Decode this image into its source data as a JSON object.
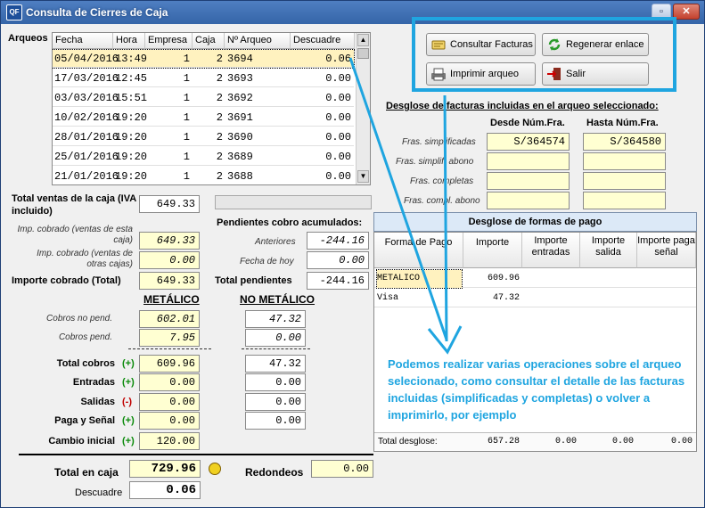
{
  "window": {
    "app_icon": "QF",
    "title": "Consulta de Cierres de Caja",
    "minimize": "▫",
    "close": "✕"
  },
  "arqueos": {
    "label": "Arqueos",
    "columns": [
      "Fecha",
      "Hora",
      "Empresa",
      "Caja",
      "Nº Arqueo",
      "Descuadre"
    ],
    "rows": [
      [
        "05/04/2016",
        "13:49",
        "1",
        "2",
        "3694",
        "0.06"
      ],
      [
        "17/03/2016",
        "12:45",
        "1",
        "2",
        "3693",
        "0.00"
      ],
      [
        "03/03/2016",
        "15:51",
        "1",
        "2",
        "3692",
        "0.00"
      ],
      [
        "10/02/2016",
        "19:20",
        "1",
        "2",
        "3691",
        "0.00"
      ],
      [
        "28/01/2016",
        "19:20",
        "1",
        "2",
        "3690",
        "0.00"
      ],
      [
        "25/01/2016",
        "19:20",
        "1",
        "2",
        "3689",
        "0.00"
      ],
      [
        "21/01/2016",
        "19:20",
        "1",
        "2",
        "3688",
        "0.00"
      ]
    ]
  },
  "actions": {
    "consultar": "Consultar Facturas",
    "regenerar": "Regenerar enlace",
    "imprimir": "Imprimir arqueo",
    "salir": "Salir"
  },
  "desglose_facturas": {
    "title": "Desglose de facturas incluidas en el arqueo seleccionado:",
    "desde": "Desde Núm.Fra.",
    "hasta": "Hasta Núm.Fra.",
    "rows": [
      {
        "label": "Fras. simplificadas",
        "desde": "S/364574",
        "hasta": "S/364580"
      },
      {
        "label": "Fras. simplif. abono",
        "desde": "",
        "hasta": ""
      },
      {
        "label": "Fras. completas",
        "desde": "",
        "hasta": ""
      },
      {
        "label": "Fras. compl. abono",
        "desde": "",
        "hasta": ""
      }
    ]
  },
  "ventas": {
    "total_label": "Total ventas de la caja (IVA incluido)",
    "total": "649.33",
    "imp_esta_label": "Imp. cobrado (ventas de esta caja)",
    "imp_esta": "649.33",
    "imp_otras_label": "Imp. cobrado (ventas de otras cajas)",
    "imp_otras": "0.00",
    "importe_cobrado_label": "Importe cobrado (Total)",
    "importe_cobrado": "649.33"
  },
  "pendientes": {
    "title": "Pendientes cobro acumulados:",
    "anteriores_label": "Anteriores",
    "anteriores": "-244.16",
    "hoy_label": "Fecha de hoy",
    "hoy": "0.00",
    "total_label": "Total pendientes",
    "total": "-244.16"
  },
  "metalico": {
    "h_metalico": "METÁLICO",
    "h_no_metalico": "NO METÁLICO",
    "rows": [
      {
        "label": "Cobros no pend.",
        "sign": "",
        "met": "602.01",
        "nomet": "47.32"
      },
      {
        "label": "Cobros pend.",
        "sign": "",
        "met": "7.95",
        "nomet": "0.00"
      },
      {
        "label": "Total cobros",
        "sign": "(+)",
        "met": "609.96",
        "nomet": "47.32"
      },
      {
        "label": "Entradas",
        "sign": "(+)",
        "met": "0.00",
        "nomet": "0.00"
      },
      {
        "label": "Salidas",
        "sign": "(-)",
        "met": "0.00",
        "nomet": "0.00"
      },
      {
        "label": "Paga y Señal",
        "sign": "(+)",
        "met": "0.00",
        "nomet": "0.00"
      },
      {
        "label": "Cambio inicial",
        "sign": "(+)",
        "met": "120.00",
        "nomet": ""
      }
    ]
  },
  "totales": {
    "total_caja_label": "Total en caja",
    "total_caja": "729.96",
    "descuadre_label": "Descuadre",
    "descuadre": "0.06",
    "redondeos_label": "Redondeos",
    "redondeos": "0.00"
  },
  "formas_pago": {
    "title": "Desglose de formas de pago",
    "columns": [
      "Forma de Pago",
      "Importe",
      "Importe entradas",
      "Importe salida",
      "Importe paga señal"
    ],
    "rows": [
      [
        "METALICO",
        "609.96",
        "",
        "",
        ""
      ],
      [
        "Visa",
        "47.32",
        "",
        "",
        ""
      ]
    ],
    "total_label": "Total desglose:",
    "totals": [
      "657.28",
      "0.00",
      "0.00",
      "0.00"
    ]
  },
  "annotation": "Podemos realizar varias operaciones sobre el arqueo selecionado, como consultar el detalle de las facturas incluidas (simplificadas y completas) o volver a imprimirlo, por ejemplo",
  "colors": {
    "callout": "#1fa5e0",
    "selected_row": "#fff2bf",
    "title_bar": "#3565a8"
  }
}
